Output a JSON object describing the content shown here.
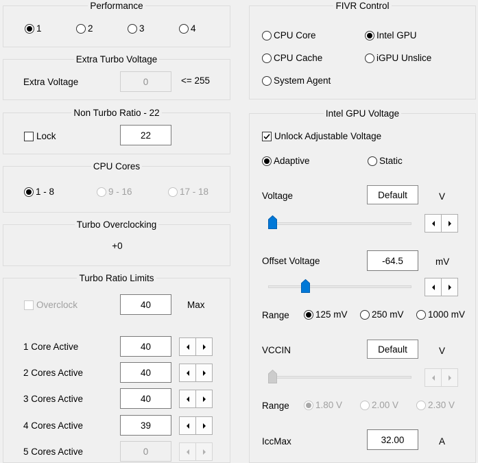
{
  "performance": {
    "title": "Performance",
    "options": [
      "1",
      "2",
      "3",
      "4"
    ],
    "selected": "1"
  },
  "extra_turbo_voltage": {
    "title": "Extra Turbo Voltage",
    "label": "Extra Voltage",
    "value": "0",
    "limit": "<= 255"
  },
  "non_turbo_ratio": {
    "title": "Non Turbo Ratio - 22",
    "lock_label": "Lock",
    "lock_checked": false,
    "value": "22"
  },
  "cpu_cores": {
    "title": "CPU Cores",
    "options": [
      "1 - 8",
      "9 - 16",
      "17 - 18"
    ],
    "selected": "1 - 8"
  },
  "turbo_overclocking": {
    "title": "Turbo Overclocking",
    "value": "+0"
  },
  "turbo_ratio_limits": {
    "title": "Turbo Ratio Limits",
    "overclock_label": "Overclock",
    "overclock_checked": false,
    "overclock_value": "40",
    "max_label": "Max",
    "rows": [
      {
        "label": "1 Core Active",
        "value": "40",
        "enabled": true
      },
      {
        "label": "2 Cores Active",
        "value": "40",
        "enabled": true
      },
      {
        "label": "3 Cores Active",
        "value": "40",
        "enabled": true
      },
      {
        "label": "4 Cores Active",
        "value": "39",
        "enabled": true
      },
      {
        "label": "5 Cores Active",
        "value": "0",
        "enabled": false
      }
    ]
  },
  "fivr_control": {
    "title": "FIVR Control",
    "options": [
      "CPU Core",
      "Intel GPU",
      "CPU Cache",
      "iGPU Unslice",
      "System Agent"
    ],
    "selected": "Intel GPU"
  },
  "intel_gpu_voltage": {
    "title": "Intel GPU Voltage",
    "unlock_label": "Unlock Adjustable Voltage",
    "unlock_checked": true,
    "mode_options": [
      "Adaptive",
      "Static"
    ],
    "mode_selected": "Adaptive",
    "voltage_label": "Voltage",
    "voltage_value": "Default",
    "voltage_unit": "V",
    "voltage_slider_fraction": 0.0,
    "offset_label": "Offset Voltage",
    "offset_value": "-64.5",
    "offset_unit": "mV",
    "offset_slider_fraction": 0.25,
    "range_label": "Range",
    "range_options": [
      "125 mV",
      "250 mV",
      "1000 mV"
    ],
    "range_selected": "125 mV",
    "vccin_label": "VCCIN",
    "vccin_value": "Default",
    "vccin_unit": "V",
    "vccin_slider_fraction": 0.0,
    "vccin_range_label": "Range",
    "vccin_range_options": [
      "1.80 V",
      "2.00 V",
      "2.30 V"
    ],
    "vccin_range_selected": "1.80 V",
    "iccmax_label": "IccMax",
    "iccmax_value": "32.00",
    "iccmax_unit": "A"
  },
  "colors": {
    "accent": "#0078d7",
    "disabled_text": "#a0a0a0",
    "group_border": "#dcdcdc",
    "background": "#f0f0f0"
  }
}
